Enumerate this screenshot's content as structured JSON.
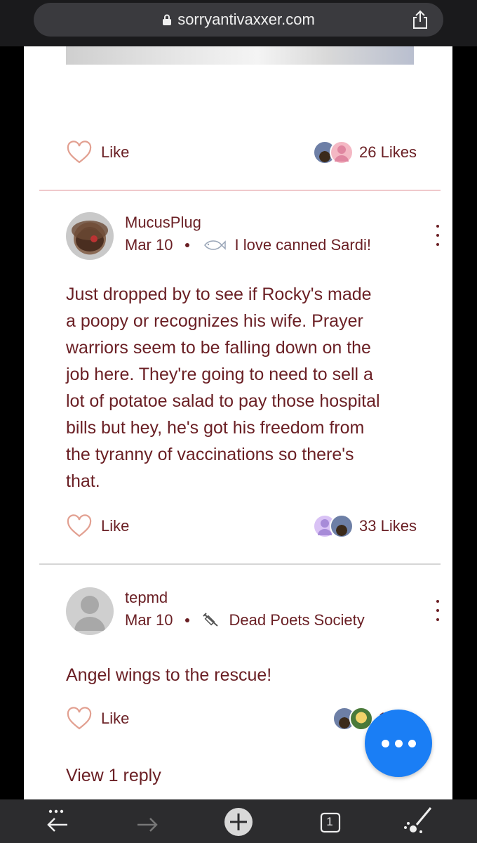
{
  "browser": {
    "url": "sorryantivaxxer.com",
    "tabs_count": "1"
  },
  "first_comment_footer": {
    "like_label": "Like",
    "likes": "26 Likes"
  },
  "comments": [
    {
      "author": "MucusPlug",
      "date": "Mar 10",
      "badge": "I love canned Sardi!",
      "badge_icon": "fish-icon",
      "text_lines": [
        "Just dropped by to see if Rocky's made",
        "a poopy or recognizes his wife. Prayer",
        "warriors seem to be falling down on the",
        "job here. They're going to need to sell a",
        "lot of potatoe salad to pay those hospital",
        "bills but hey, he's got his freedom from",
        "the tyranny of vaccinations so there's",
        "that."
      ],
      "like_label": "Like",
      "likes": "33 Likes"
    },
    {
      "author": "tepmd",
      "date": "Mar 10",
      "badge": "Dead Poets Society",
      "badge_icon": "syringe-icon",
      "text_lines": [
        "Angel wings to the rescue!"
      ],
      "like_label": "Like",
      "likes": "10"
    }
  ],
  "view_replies": "View 1 reply",
  "colors": {
    "text": "#6a1f24",
    "heart": "#e2a091",
    "fab": "#1a7ef5",
    "divider_pink": "#f0c9cc",
    "divider_gray": "#d6d6d6"
  }
}
